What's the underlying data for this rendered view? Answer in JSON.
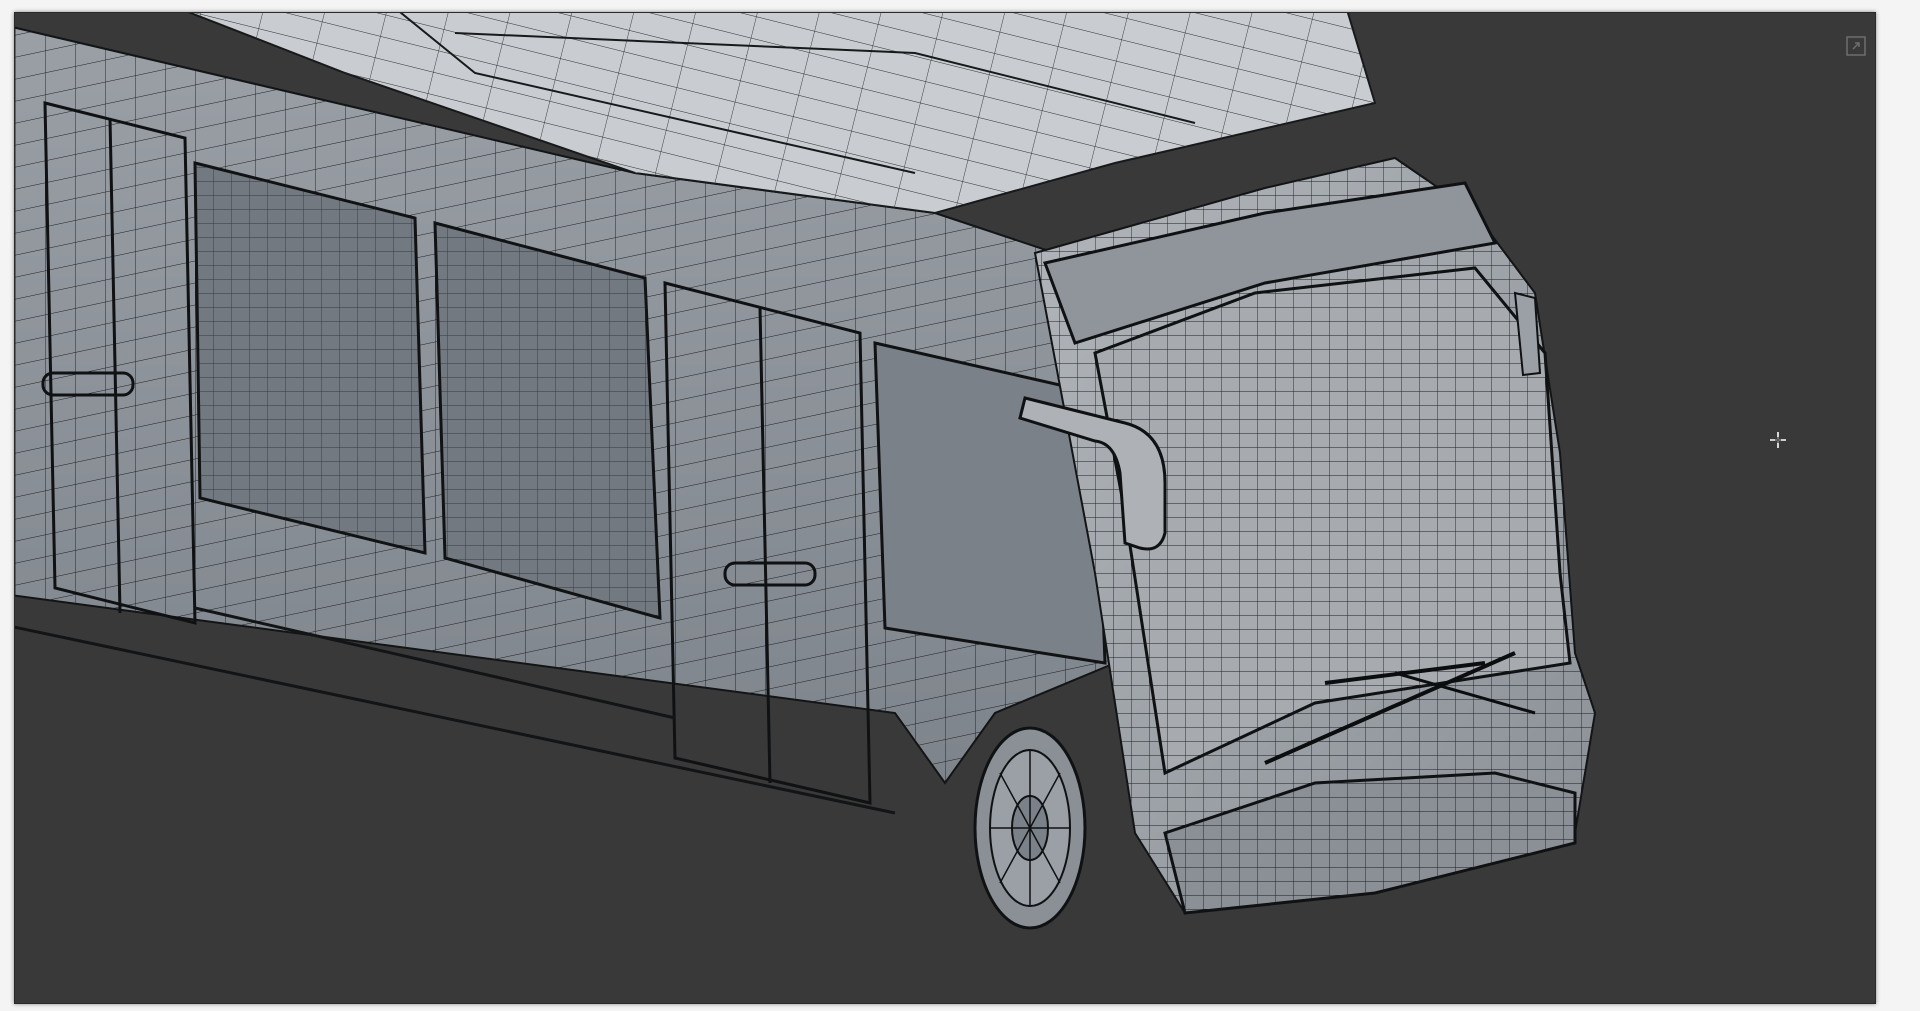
{
  "viewport": {
    "background_color": "#393939",
    "shading_mode": "wireframe-on-shaded",
    "model_color": "#8d9298",
    "roof_color": "#cfd2d5",
    "wire_color": "#141618"
  },
  "icons": {
    "maximize": "maximize-viewport-icon",
    "cursor": "crosshair-cursor-icon"
  }
}
